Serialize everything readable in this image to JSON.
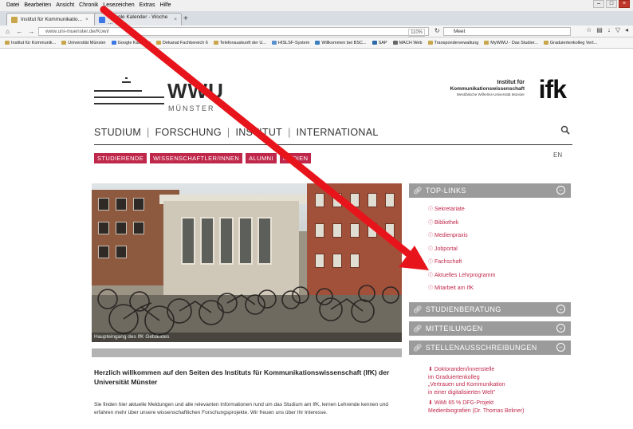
{
  "browser": {
    "menu": [
      "Datei",
      "Bearbeiten",
      "Ansicht",
      "Chronik",
      "Lesezeichen",
      "Extras",
      "Hilfe"
    ],
    "tabs": [
      {
        "label": "Institut für Kommunikatio...",
        "color": "#c9a64a"
      },
      {
        "label": "Google Kalender - Woche ...",
        "color": "#3b78e7"
      }
    ],
    "url": "www.uni-muenster.de/Kowi/",
    "zoom": "110%",
    "search_value": "Meet",
    "bookmarks": [
      "Institut für Kommunik...",
      "Universität Münster",
      "Google Kalender",
      "Dekanat Fachbereich 6",
      "Telefonauskunft der U...",
      "HISLSF-System",
      "Willkommen bei BSC...",
      "SAP",
      "MACH Web",
      "Transpondervewaltung",
      "MyWWU - Das Studier...",
      "Graduiertenkolleg Vert..."
    ]
  },
  "page": {
    "logo_wwu": "WWU",
    "logo_muenster": "MÜNSTER",
    "logo_ifk": {
      "line1": "Institut für",
      "line2": "Kommunikationswissenschaft",
      "line3": "Westfälische Wilhelms-Universität Münster",
      "mark": "ifk"
    },
    "mainnav": [
      "STUDIUM",
      "FORSCHUNG",
      "INSTITUT",
      "INTERNATIONAL"
    ],
    "subnav": [
      "STUDIERENDE",
      "WISSENSCHAFTLER/INNEN",
      "ALUMNI",
      "MEDIEN"
    ],
    "lang": "EN",
    "hero_caption": "Haupteingang des IfK Gebäudes",
    "welcome_title": "Herzlich willkommen auf den Seiten des Instituts für Kommunikationswissenschaft (IfK) der Universität Münster",
    "welcome_text": "Sie finden hier aktuelle Meldungen und alle relevanten Informationen rund um das Studium am IfK, lernen Lehrende kennen und erfahren mehr über unsere wissenschaftlichen Forschungsprojekte. Wir freuen uns über Ihr Interesse.",
    "sidebar": {
      "toplinks_title": "TOP-LINKS",
      "toplinks": [
        "Sekretariate",
        "Bibliothek",
        "Medienpraxis",
        "Jobportal",
        "Fachschaft",
        "Aktuelles Lehrprogramm",
        "Mitarbeit am IfK"
      ],
      "studienberatung": "STUDIENBERATUNG",
      "mitteilungen": "MITTEILUNGEN",
      "stellen": "STELLENAUSSCHREIBUNGEN",
      "jobs": [
        [
          "Doktoranden/innenstelle",
          "im Graduiertenkolleg",
          "„Vertrauen und Kommunikation",
          "in einer digitalisierten Welt\""
        ],
        [
          "WiMi 65 % DFG-Projekt",
          "Medienbiografien (Dr. Thomas Birkner)"
        ]
      ]
    },
    "accent": "#c0284b",
    "arrow_color": "#e8141b"
  }
}
